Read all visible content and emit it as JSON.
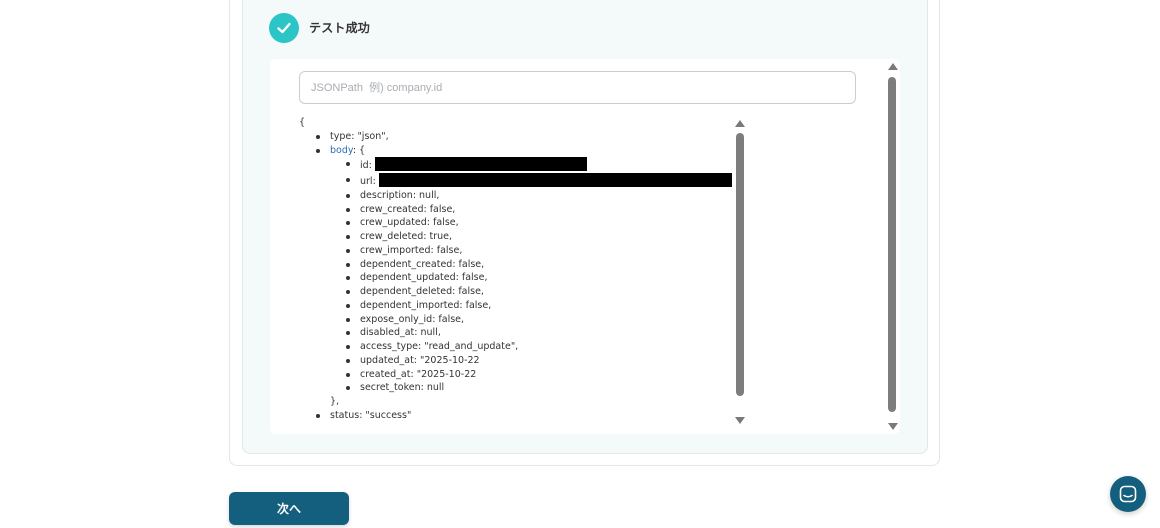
{
  "colors": {
    "accent": "#2bc4c7",
    "primary_button": "#145f7d",
    "panel_bg": "#f4faf9"
  },
  "result": {
    "title": "テスト成功",
    "icon": "check-circle-icon"
  },
  "search": {
    "placeholder": "JSONPath  例) company.id",
    "value": ""
  },
  "json": {
    "open": "{",
    "type_line": "type: \"json\",",
    "body_key": "body",
    "body_open": ": {",
    "id_label": "id:",
    "url_label": "url:",
    "fields": [
      "description: null,",
      "crew_created: false,",
      "crew_updated: false,",
      "crew_deleted: true,",
      "crew_imported: false,",
      "dependent_created: false,",
      "dependent_updated: false,",
      "dependent_deleted: false,",
      "dependent_imported: false,",
      "expose_only_id: false,",
      "disabled_at: null,",
      "access_type: \"read_and_update\",",
      "updated_at: \"2025-10-22",
      "created_at: \"2025-10-22",
      "secret_token: null"
    ],
    "body_close": "},",
    "status_line": "status: \"success\""
  },
  "buttons": {
    "next_label": "次へ",
    "chat_icon": "chat-icon"
  }
}
